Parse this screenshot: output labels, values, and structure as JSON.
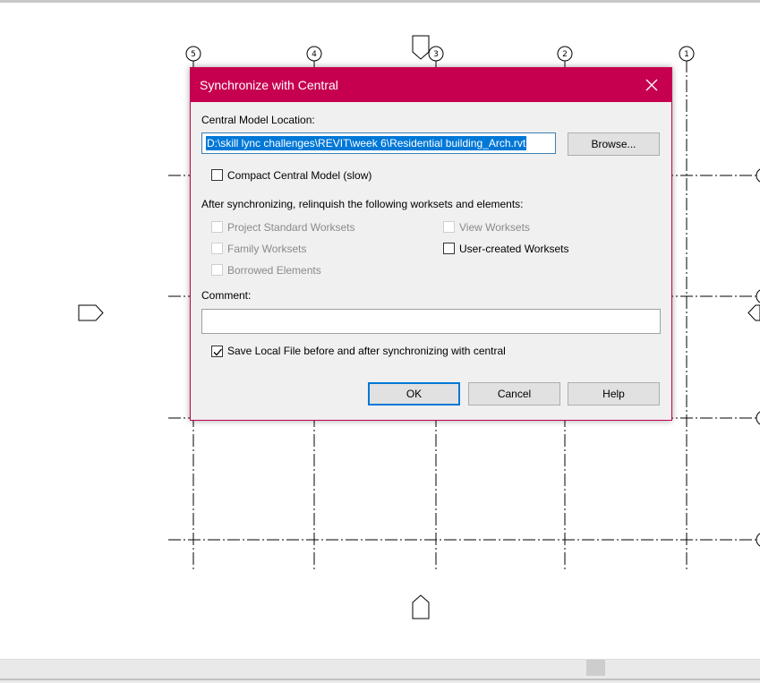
{
  "dialog": {
    "title": "Synchronize with Central",
    "central_label": "Central Model Location:",
    "central_path": "D:\\skill lync challenges\\REVIT\\week 6\\Residential building_Arch.rvt",
    "browse_label": "Browse...",
    "compact_label": "Compact Central Model (slow)",
    "compact_checked": false,
    "relinquish_label": "After synchronizing, relinquish the following worksets and elements:",
    "relinquish_options": [
      {
        "label": "Project Standard Worksets",
        "checked": false,
        "enabled": false
      },
      {
        "label": "View Worksets",
        "checked": false,
        "enabled": false
      },
      {
        "label": "Family Worksets",
        "checked": false,
        "enabled": false
      },
      {
        "label": "User-created Worksets",
        "checked": false,
        "enabled": true
      },
      {
        "label": "Borrowed Elements",
        "checked": false,
        "enabled": false
      }
    ],
    "comment_label": "Comment:",
    "comment_value": "",
    "save_local_label": "Save Local File before and after synchronizing with central",
    "save_local_checked": true,
    "buttons": {
      "ok": "OK",
      "cancel": "Cancel",
      "help": "Help"
    }
  },
  "drawing": {
    "grid_labels": [
      "5",
      "4",
      "3",
      "2",
      "1"
    ]
  },
  "colors": {
    "title_bar": "#c6004f",
    "selection": "#0078d7"
  }
}
